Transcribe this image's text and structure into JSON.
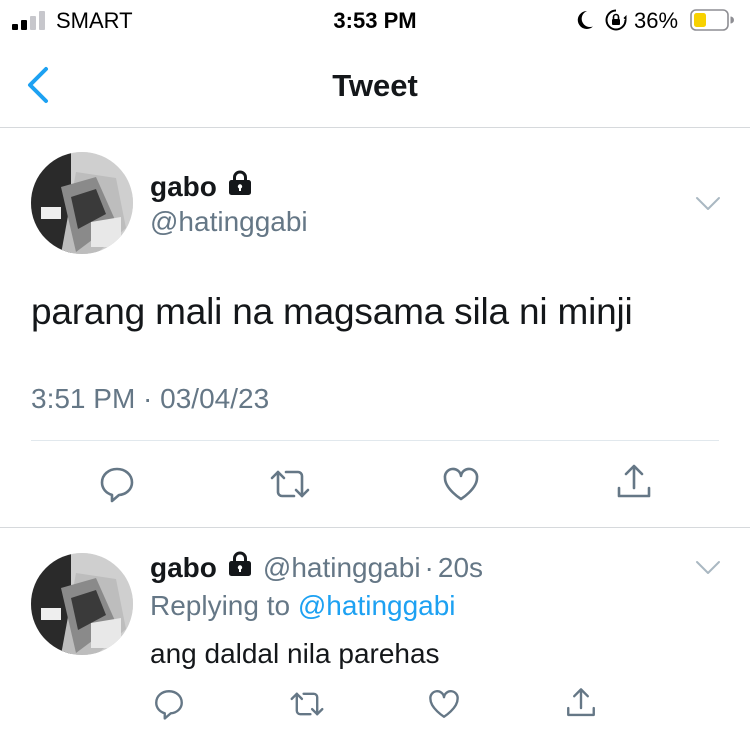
{
  "status_bar": {
    "carrier": "SMART",
    "time": "3:53 PM",
    "battery_percent": "36%",
    "icons": [
      "signal-icon",
      "moon-icon",
      "orientation-lock-icon",
      "battery-icon"
    ]
  },
  "header": {
    "title": "Tweet",
    "back_icon": "chevron-left-icon"
  },
  "main_tweet": {
    "name": "gabo",
    "handle": "@hatinggabi",
    "text": "parang mali na magsama sila ni minji",
    "timestamp": "3:51 PM · 03/04/23",
    "protected_icon": "lock-icon",
    "actions": [
      "reply-icon",
      "retweet-icon",
      "like-icon",
      "share-icon"
    ]
  },
  "reply": {
    "name": "gabo",
    "handle": "@hatinggabi",
    "separator": "·",
    "time": "20s",
    "replying_prefix": "Replying to",
    "replying_to": "@hatinggabi",
    "text": "ang daldal nila parehas",
    "actions": [
      "reply-icon",
      "retweet-icon",
      "like-icon",
      "share-icon"
    ]
  },
  "colors": {
    "accent": "#1da1f2",
    "text_primary": "#14171a",
    "text_secondary": "#657786",
    "icon": "#657786",
    "battery_fill": "#f7d100"
  }
}
